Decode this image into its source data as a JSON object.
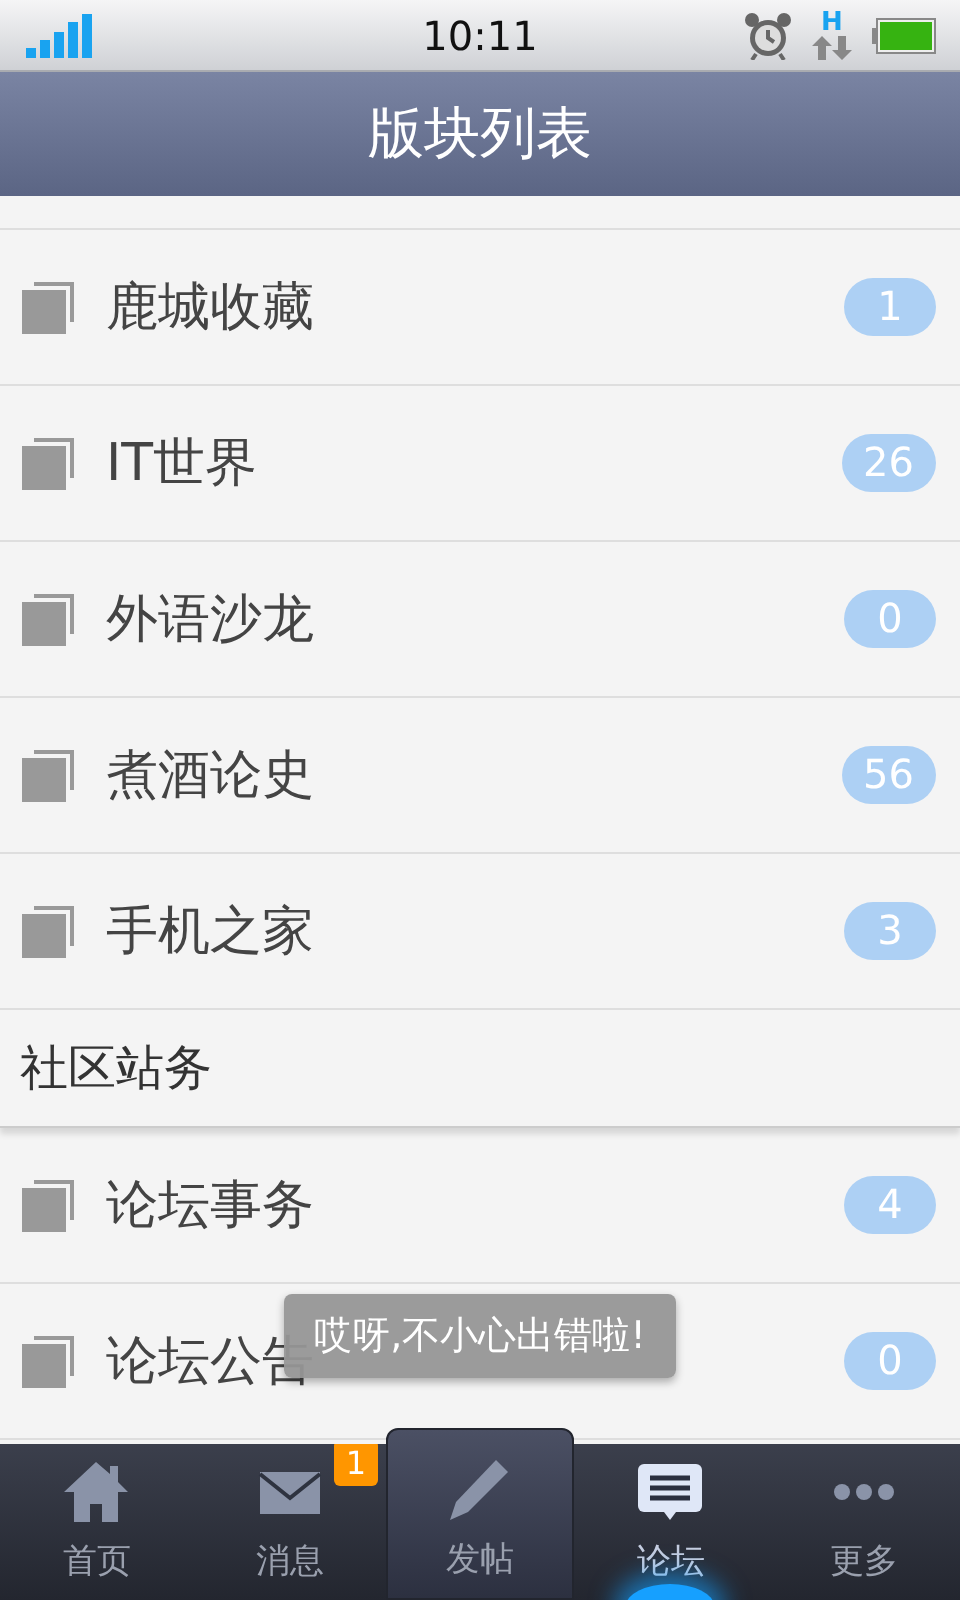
{
  "status_bar": {
    "time": "10:11",
    "network": "H"
  },
  "header": {
    "title": "版块列表"
  },
  "sections": [
    {
      "items": [
        {
          "name": "鹿城收藏",
          "count": "1"
        },
        {
          "name": "IT世界",
          "count": "26"
        },
        {
          "name": "外语沙龙",
          "count": "0"
        },
        {
          "name": "煮酒论史",
          "count": "56"
        },
        {
          "name": "手机之家",
          "count": "3"
        }
      ]
    },
    {
      "title": "社区站务",
      "items": [
        {
          "name": "论坛事务",
          "count": "4"
        },
        {
          "name": "论坛公告",
          "count": "0"
        }
      ]
    }
  ],
  "toast": {
    "text": "哎呀,不小心出错啦!"
  },
  "tabs": [
    {
      "kind": "home",
      "label": "首页",
      "selected": false
    },
    {
      "kind": "mail",
      "label": "消息",
      "selected": false,
      "badge": "1"
    },
    {
      "kind": "compose",
      "label": "发帖",
      "selected": false
    },
    {
      "kind": "forum",
      "label": "论坛",
      "selected": true
    },
    {
      "kind": "more",
      "label": "更多",
      "selected": false
    }
  ]
}
